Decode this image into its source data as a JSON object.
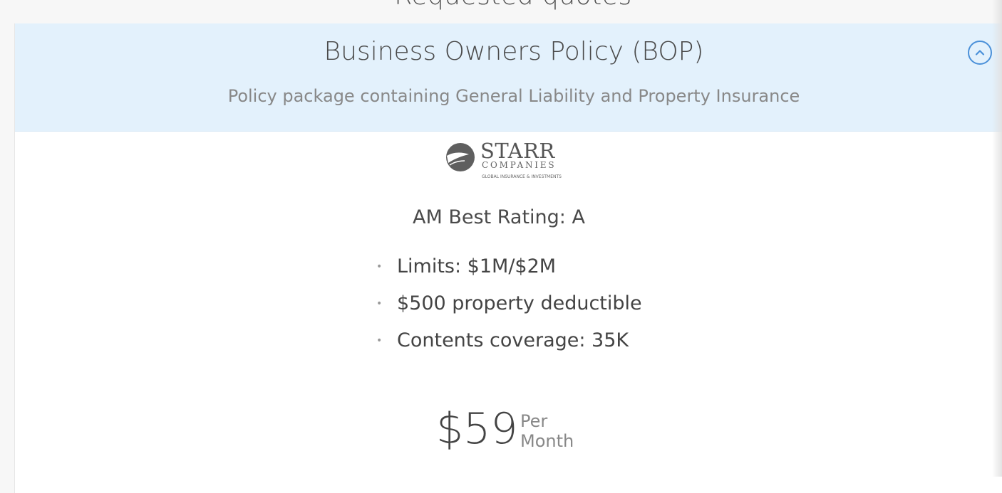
{
  "section_heading": "Requested quotes",
  "policy": {
    "title": "Business Owners Policy (BOP)",
    "subtitle": "Policy package containing General Liability and Property Insurance"
  },
  "carrier": {
    "logo_name": "STARR",
    "logo_sub": "COMPANIES",
    "logo_tag": "GLOBAL INSURANCE & INVESTMENTS",
    "rating": "AM Best Rating: A"
  },
  "features": [
    "Limits: $1M/$2M",
    "$500 property deductible",
    "Contents coverage: 35K"
  ],
  "price": {
    "amount": "$59",
    "per_line1": "Per",
    "per_line2": "Month"
  },
  "icons": {
    "collapse": "chevron-up-icon",
    "bullet": "bullet-dot-icon"
  },
  "colors": {
    "header_bg": "#e3f1fc",
    "accent": "#4a90d9"
  }
}
